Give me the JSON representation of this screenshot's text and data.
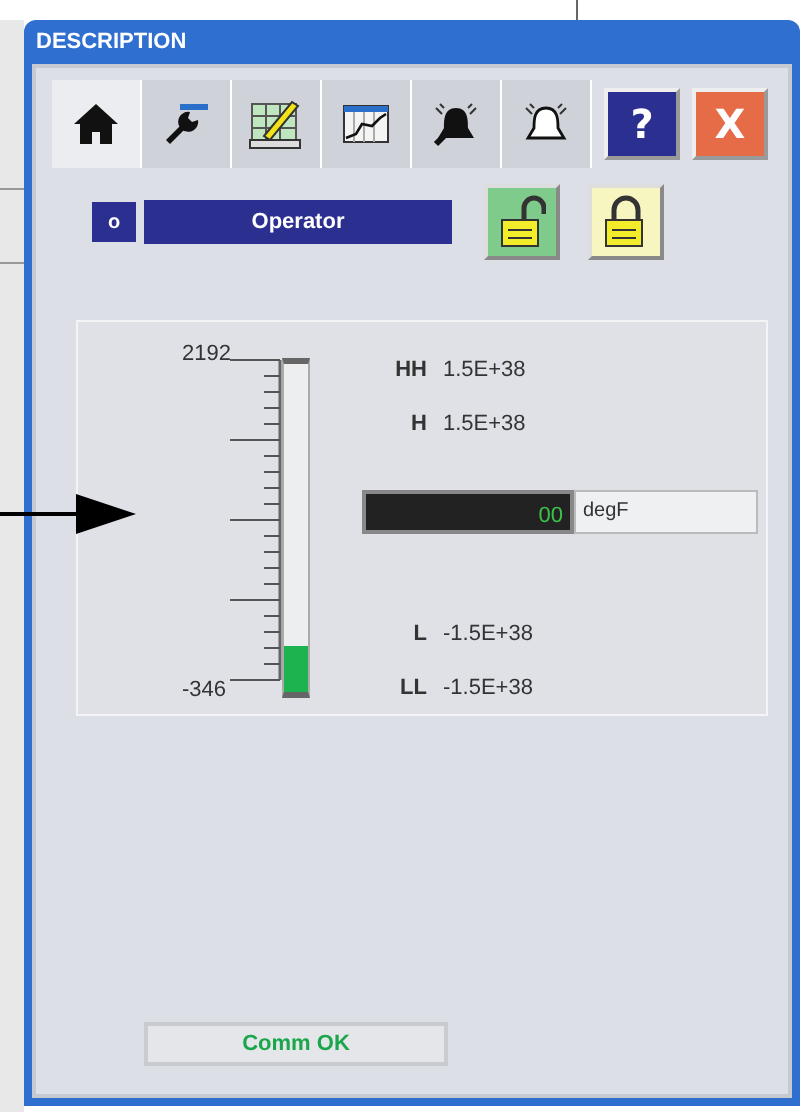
{
  "window": {
    "title": "DESCRIPTION"
  },
  "tabs": [
    {
      "kind": "home",
      "selected": true
    },
    {
      "kind": "wrench",
      "selected": false
    },
    {
      "kind": "grid-pencil",
      "selected": false
    },
    {
      "kind": "trend",
      "selected": false
    },
    {
      "kind": "alarm-dark",
      "selected": false
    },
    {
      "kind": "bell",
      "selected": false
    }
  ],
  "help_button": "?",
  "close_button": "X",
  "operator": {
    "code": "o",
    "label": "Operator"
  },
  "locks": [
    {
      "locked": false
    },
    {
      "locked": true
    }
  ],
  "gauge": {
    "max": "2192",
    "min": "-346",
    "level": 0.14
  },
  "limits_high": [
    {
      "label": "HH",
      "value": "1.5E+38"
    },
    {
      "label": "H",
      "value": "1.5E+38"
    }
  ],
  "reading": {
    "value": "00",
    "unit": "degF"
  },
  "limits_low": [
    {
      "label": "L",
      "value": "-1.5E+38"
    },
    {
      "label": "LL",
      "value": "-1.5E+38"
    }
  ],
  "status": "Comm OK"
}
